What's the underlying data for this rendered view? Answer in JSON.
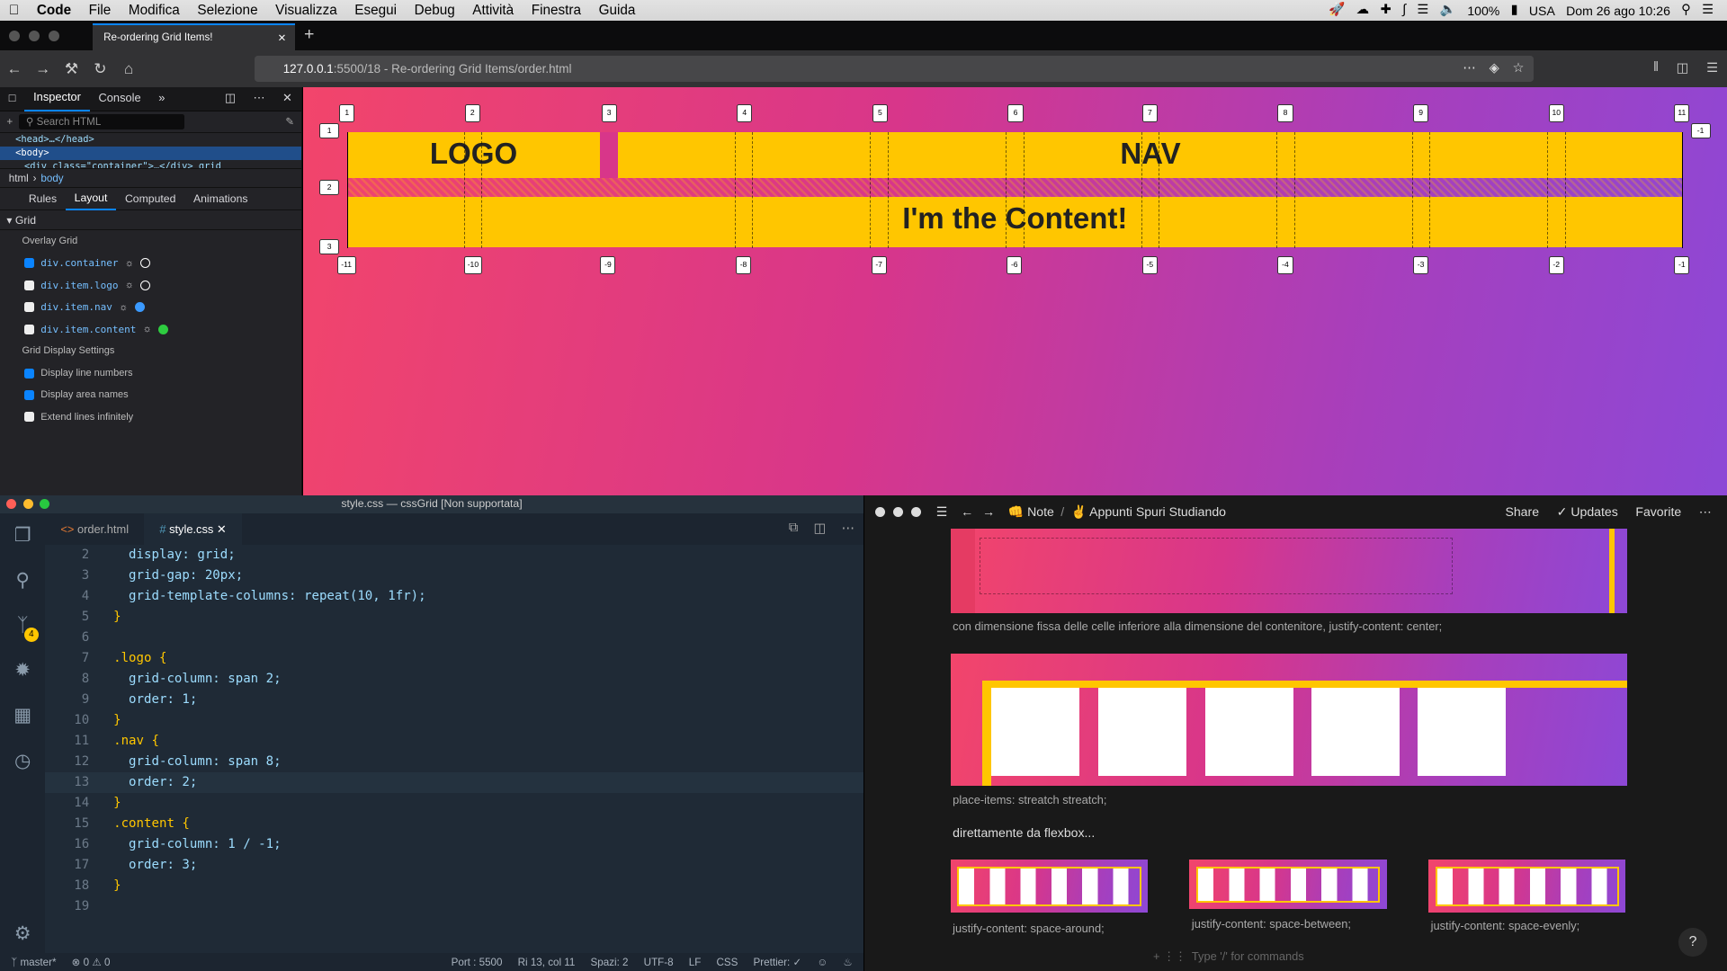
{
  "menubar": {
    "app": "Code",
    "items": [
      "File",
      "Modifica",
      "Selezione",
      "Visualizza",
      "Esegui",
      "Debug",
      "Attività",
      "Finestra",
      "Guida"
    ],
    "battery": "100%",
    "locale": "USA",
    "datetime": "Dom 26 ago  10:26"
  },
  "browser": {
    "tab_title": "Re-ordering Grid Items!",
    "url_host": "127.0.0.1",
    "url_rest": ":5500/18 - Re-ordering Grid Items/order.html"
  },
  "devtools": {
    "tabs": [
      "Inspector",
      "Console"
    ],
    "search_placeholder": "Search HTML",
    "tree": [
      "<head>…</head>",
      "<body>",
      "<div class=\"container\">…</div> grid"
    ],
    "crumbs": [
      "html",
      "body"
    ],
    "subtabs": [
      "Rules",
      "Layout",
      "Computed",
      "Animations"
    ],
    "section": "Grid",
    "overlay_label": "Overlay Grid",
    "grids": [
      {
        "name": "div.container",
        "checked": true,
        "color": "#ffffff"
      },
      {
        "name": "div.item.logo",
        "checked": false,
        "color": "#ffffff"
      },
      {
        "name": "div.item.nav",
        "checked": false,
        "color": "#3b9aff"
      },
      {
        "name": "div.item.content",
        "checked": false,
        "color": "#2ecc40"
      }
    ],
    "settings_label": "Grid Display Settings",
    "settings": [
      {
        "label": "Display line numbers",
        "checked": true
      },
      {
        "label": "Display area names",
        "checked": true
      },
      {
        "label": "Extend lines infinitely",
        "checked": false
      }
    ]
  },
  "grid": {
    "logo_text": "LOGO",
    "nav_text": "NAV",
    "content_text": "I'm the Content!",
    "col_top": [
      "1",
      "2",
      "3",
      "4",
      "5",
      "6",
      "7",
      "8",
      "9",
      "10",
      "11"
    ],
    "col_bottom": [
      "-11",
      "-10",
      "-9",
      "-8",
      "-7",
      "-6",
      "-5",
      "-4",
      "-3",
      "-2",
      "-1"
    ],
    "row_left": [
      "1",
      "2",
      "3"
    ],
    "row_right": "-1"
  },
  "vscode": {
    "title": "style.css — cssGrid [Non supportata]",
    "tabs": [
      "order.html",
      "style.css"
    ],
    "lines": [
      {
        "n": "2",
        "t": "  display: grid;"
      },
      {
        "n": "3",
        "t": "  grid-gap: 20px;"
      },
      {
        "n": "4",
        "t": "  grid-template-columns: repeat(10, 1fr);"
      },
      {
        "n": "5",
        "t": "}"
      },
      {
        "n": "6",
        "t": ""
      },
      {
        "n": "7",
        "t": ".logo {"
      },
      {
        "n": "8",
        "t": "  grid-column: span 2;"
      },
      {
        "n": "9",
        "t": "  order: 1;"
      },
      {
        "n": "10",
        "t": "}"
      },
      {
        "n": "11",
        "t": ".nav {"
      },
      {
        "n": "12",
        "t": "  grid-column: span 8;"
      },
      {
        "n": "13",
        "t": "  order: 2;"
      },
      {
        "n": "14",
        "t": "}"
      },
      {
        "n": "15",
        "t": ".content {"
      },
      {
        "n": "16",
        "t": "  grid-column: 1 / -1;"
      },
      {
        "n": "17",
        "t": "  order: 3;"
      },
      {
        "n": "18",
        "t": "}"
      },
      {
        "n": "19",
        "t": ""
      }
    ],
    "status": {
      "branch": "master*",
      "errors": "0",
      "warnings": "0",
      "port": "Port : 5500",
      "cursor": "Ri 13, col 11",
      "spaces": "Spazi: 2",
      "encoding": "UTF-8",
      "eol": "LF",
      "lang": "CSS",
      "prettier": "Prettier: ✓",
      "scm_count": "4"
    }
  },
  "notion": {
    "breadcrumb1": "👊 Note",
    "breadcrumb2": "✌️ Appunti Spuri Studiando",
    "share": "Share",
    "updates": "Updates",
    "favorite": "Favorite",
    "caption1": "con dimensione fissa delle celle inferiore alla dimensione del contenitore, justify-content: center;",
    "caption2": "place-items: streatch streatch;",
    "heading": "direttamente da flexbox...",
    "thumb_captions": [
      "justify-content: space-around;",
      "justify-content: space-between;",
      "justify-content: space-evenly;"
    ],
    "placeholder": "Type '/' for commands",
    "help": "?"
  }
}
